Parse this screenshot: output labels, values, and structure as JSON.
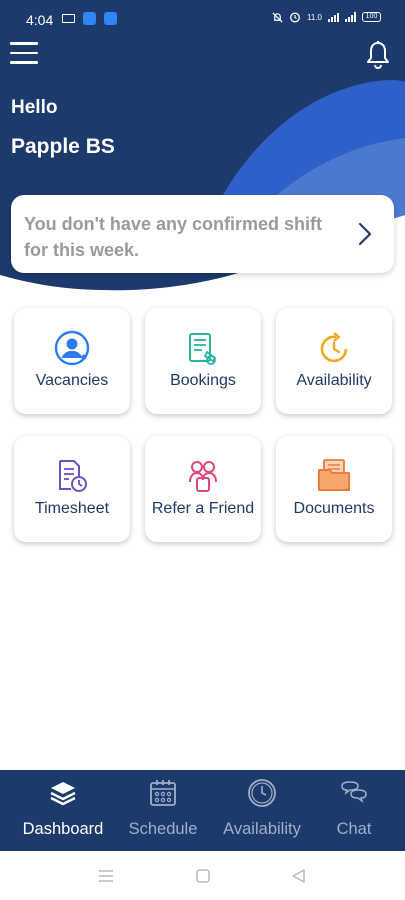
{
  "status_bar": {
    "time": "4:04",
    "speed": "11.0",
    "battery": "100"
  },
  "greeting": {
    "hello": "Hello",
    "name": "Papple BS"
  },
  "shift_card": {
    "message": "You don't have any confirmed shift for this week."
  },
  "tiles": [
    {
      "label": "Vacancies",
      "icon": "user-circle-icon",
      "color": "#2e7bf0"
    },
    {
      "label": "Bookings",
      "icon": "clipboard-icon",
      "color": "#2bb3a0"
    },
    {
      "label": "Availability",
      "icon": "clock-refresh-icon",
      "color": "#f2a81d"
    },
    {
      "label": "Timesheet",
      "icon": "timesheet-icon",
      "color": "#6f4fc2"
    },
    {
      "label": "Refer a Friend",
      "icon": "people-icon",
      "color": "#e0457b"
    },
    {
      "label": "Documents",
      "icon": "folder-icon",
      "color": "#f07a3a"
    }
  ],
  "bottom_nav": [
    {
      "label": "Dashboard",
      "icon": "layers-icon",
      "active": true
    },
    {
      "label": "Schedule",
      "icon": "calendar-icon",
      "active": false
    },
    {
      "label": "Availability",
      "icon": "clock-icon",
      "active": false
    },
    {
      "label": "Chat",
      "icon": "chat-bubbles-icon",
      "active": false
    }
  ],
  "colors": {
    "header_dark": "#1d3a6d",
    "wave_light": "#4b79d1",
    "wave_bright": "#2f6fe0",
    "label_text": "#1f3a66"
  }
}
